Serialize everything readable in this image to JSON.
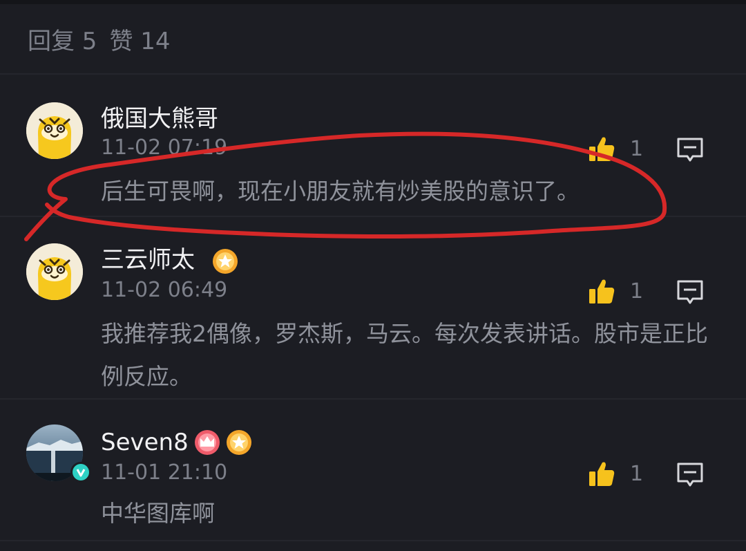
{
  "header": {
    "replies_label": "回复 5",
    "likes_label": "赞 14"
  },
  "comments": [
    {
      "username": "俄国大熊哥",
      "timestamp": "11-02 07:19",
      "text": "后生可畏啊，现在小朋友就有炒美股的意识了。",
      "likes": "1",
      "avatar_icon": "tiger-avatar",
      "badges": []
    },
    {
      "username": "三云师太",
      "timestamp": "11-02 06:49",
      "text": "我推荐我2偶像，罗杰斯，马云。每次发表讲话。股市是正比例反应。",
      "likes": "1",
      "avatar_icon": "tiger-avatar",
      "badges": [
        "star-badge"
      ]
    },
    {
      "username": "Seven8",
      "timestamp": "11-01 21:10",
      "text": "中华图库啊",
      "likes": "1",
      "avatar_icon": "lake-photo-avatar",
      "badges": [
        "crown-badge",
        "star-badge"
      ],
      "verified": true
    }
  ],
  "colors": {
    "background": "#1c1d23",
    "like_icon": "#f6c21d",
    "star_badge": "#f4a62a",
    "crown_badge": "#ef5b6a",
    "annotation_stroke": "#d62828",
    "verified_badge": "#2ed1c4"
  }
}
